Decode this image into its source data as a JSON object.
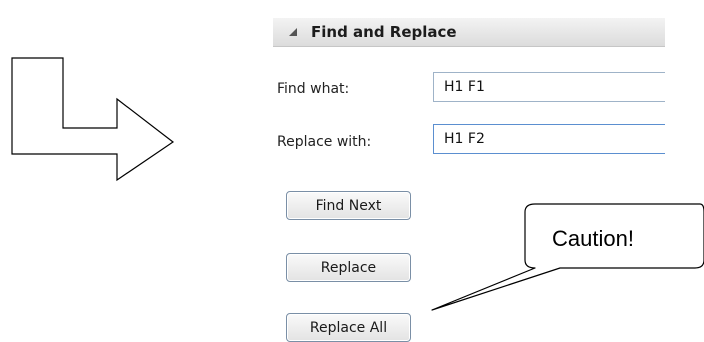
{
  "panel": {
    "title": "Find and Replace",
    "collapse_icon": "collapse-triangle-icon"
  },
  "fields": {
    "find_label": "Find what:",
    "find_value": "H1 F1",
    "replace_label": "Replace with:",
    "replace_value": "H1 F2"
  },
  "buttons": {
    "find_next": "Find Next",
    "replace": "Replace",
    "replace_all": "Replace All"
  },
  "annotation": {
    "callout_text": "Caution!",
    "arrow_icon": "bent-arrow-right-icon"
  }
}
